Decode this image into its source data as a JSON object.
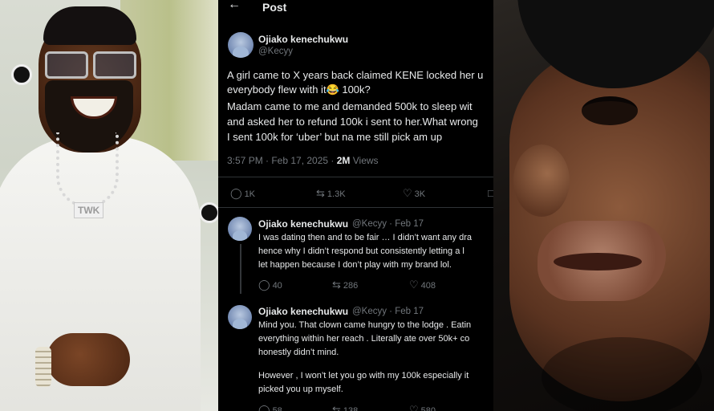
{
  "header": {
    "title": "Post"
  },
  "tweet": {
    "name": "Ojiako kenechukwu",
    "handle": "@Kecyy",
    "lines": [
      "A girl came to X years back claimed KENE locked her u",
      "everybody flew with it😂 100k?",
      "Madam came to me and demanded 500k to sleep wit",
      "and asked her to refund 100k i sent to her.What wrong",
      "I sent 100k for ‘uber’ but na me still pick am up"
    ],
    "time": "3:57 PM · Feb 17, 2025 ·",
    "views_count": "2M",
    "views_label": "Views",
    "stats": {
      "replies": "1K",
      "reposts": "1.3K",
      "likes": "3K"
    }
  },
  "replies": [
    {
      "name": "Ojiako kenechukwu",
      "handle": "@Kecyy · Feb 17",
      "lines": [
        "I was dating then and to be fair … I didn’t want any dra",
        "hence why I didn’t respond but consistently letting a l",
        "let happen because I don’t play with my brand lol."
      ],
      "stats": {
        "replies": "40",
        "reposts": "286",
        "likes": "408"
      }
    },
    {
      "name": "Ojiako kenechukwu",
      "handle": "@Kecyy · Feb 17",
      "lines": [
        "Mind you. That clown came hungry to the lodge . Eatin",
        "everything within her reach . Literally ate over 50k+ co",
        "honestly didn’t mind.",
        "",
        "However , I won’t let you go with my 100k especially it",
        "picked you up myself."
      ],
      "stats": {
        "replies": "58",
        "reposts": "138",
        "likes": "580"
      }
    }
  ],
  "left_photo": {
    "pendant_text": "TWK"
  },
  "colors": {
    "background": "#000000",
    "text": "#e7e9ea",
    "muted": "#71767b",
    "divider": "#2f3336"
  }
}
